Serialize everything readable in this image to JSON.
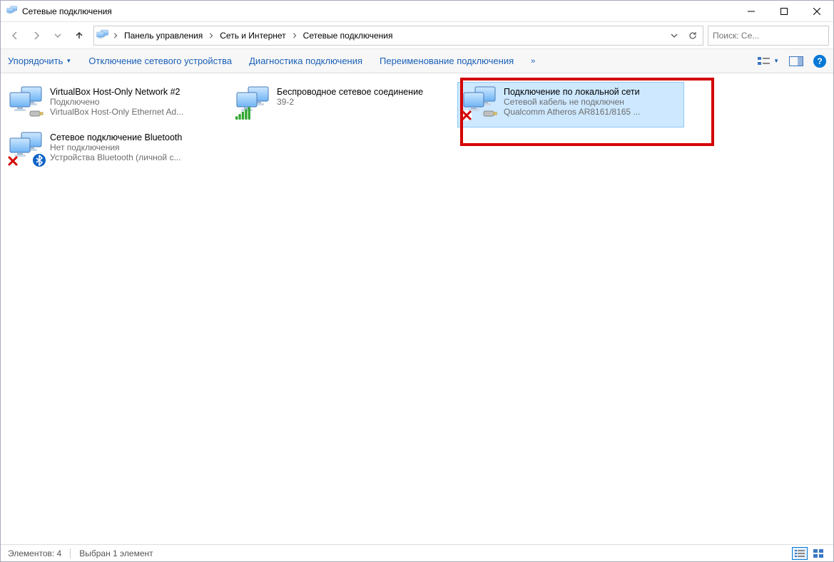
{
  "window": {
    "title": "Сетевые подключения"
  },
  "breadcrumbs": {
    "b0": "Панель управления",
    "b1": "Сеть и Интернет",
    "b2": "Сетевые подключения"
  },
  "search": {
    "placeholder": "Поиск: Се..."
  },
  "commands": {
    "organize": "Упорядочить",
    "disable": "Отключение сетевого устройства",
    "diagnose": "Диагностика подключения",
    "rename": "Переименование подключения",
    "overflow": "»"
  },
  "connections": {
    "c0": {
      "name": "VirtualBox Host-Only Network #2",
      "status": "Подключено",
      "device": "VirtualBox Host-Only Ethernet Ad..."
    },
    "c1": {
      "name": "Беспроводное сетевое соединение",
      "status": "39-2",
      "device": ""
    },
    "c2": {
      "name": "Подключение по локальной сети",
      "status": "Сетевой кабель не подключен",
      "device": "Qualcomm Atheros AR8161/8165 ..."
    },
    "c3": {
      "name": "Сетевое подключение Bluetooth",
      "status": "Нет подключения",
      "device": "Устройства Bluetooth (личной с..."
    }
  },
  "status": {
    "count": "Элементов: 4",
    "selected": "Выбран 1 элемент"
  }
}
